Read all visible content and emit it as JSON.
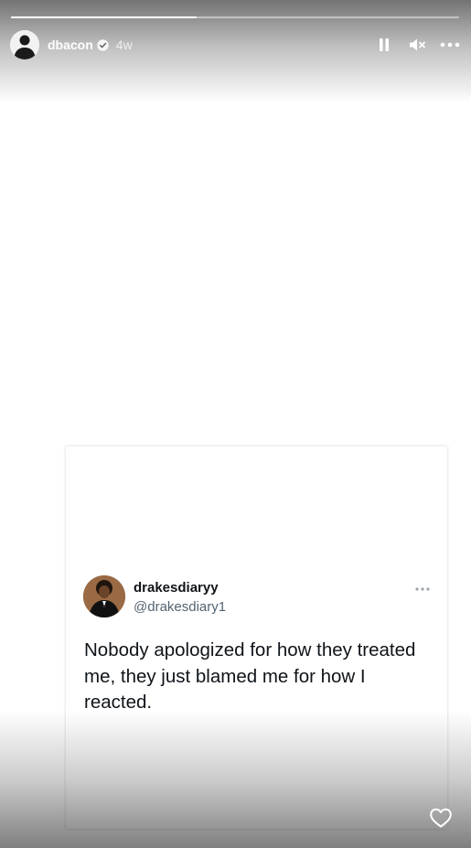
{
  "story": {
    "progress": 0.415,
    "user": {
      "username": "dbacon",
      "verified": true,
      "time_ago": "4w"
    },
    "controls": {
      "pause_icon": "pause-icon",
      "mute_icon": "speaker-muted-icon",
      "more_icon": "more-horizontal-icon"
    },
    "like_icon": "heart-outline-icon"
  },
  "tweet": {
    "display_name": "drakesdiaryy",
    "handle": "@drakesdiary1",
    "text": "Nobody apologized for how they treated me, they just blamed me for how I reacted.",
    "more_icon": "more-horizontal-icon"
  },
  "colors": {
    "tweet_text": "#0f1419",
    "tweet_handle": "#536471",
    "overlay_text": "#ffffff"
  }
}
